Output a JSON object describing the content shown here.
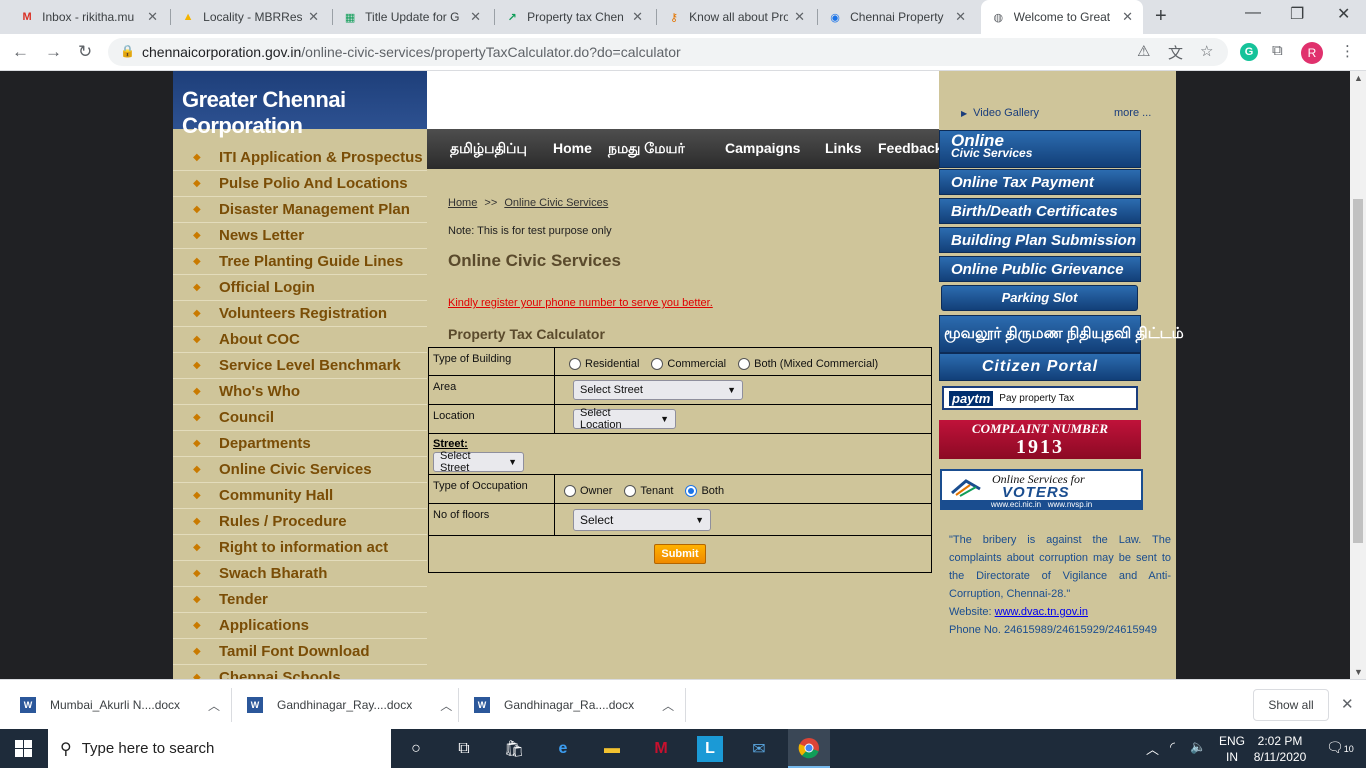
{
  "browser": {
    "tabs": [
      {
        "label": "Inbox - rikitha.mu",
        "icon": "gmail-icon",
        "glyph": "M",
        "color": "#d93025"
      },
      {
        "label": "Locality - MBRRes",
        "icon": "drive-icon",
        "glyph": "▲",
        "color": "#f4b400"
      },
      {
        "label": "Title Update for G",
        "icon": "sheets-icon",
        "glyph": "▦",
        "color": "#0f9d58"
      },
      {
        "label": "Property tax Chen",
        "icon": "trend-icon",
        "glyph": "↗",
        "color": "#0f9d58"
      },
      {
        "label": "Know all about Pro",
        "icon": "key-icon",
        "glyph": "⚷",
        "color": "#e37400"
      },
      {
        "label": "Chennai Property",
        "icon": "globe-icon",
        "glyph": "◉",
        "color": "#1a73e8"
      },
      {
        "label": "Welcome to Great",
        "icon": "globe-icon",
        "glyph": "◍",
        "color": "#5f6368"
      }
    ],
    "url_host": "chennaicorporation.gov.in",
    "url_path": "/online-civic-services/propertyTaxCalculator.do?do=calculator",
    "avatar_letter": "R",
    "ext_letter": "G"
  },
  "site": {
    "logo_text": "Greater Chennai Corporation",
    "left_menu": [
      "ITI Application & Prospectus",
      "Pulse Polio And Locations",
      "Disaster Management Plan",
      "News Letter",
      "Tree Planting Guide Lines",
      "Official Login",
      "Volunteers Registration",
      "About COC",
      "Service Level Benchmark",
      "Who's Who",
      "Council",
      "Departments",
      "Online Civic Services",
      "Community Hall",
      "Rules / Procedure",
      "Right to information act",
      "Swach Bharath",
      "Tender",
      "Applications",
      "Tamil Font Download",
      "Chennai Schools"
    ],
    "nav": [
      "தமிழ்பதிப்பு",
      "Home",
      "நமது மேயர்",
      "Campaigns",
      "Links",
      "Feedback"
    ],
    "breadcrumb_home": "Home",
    "breadcrumb_sep": ">>",
    "breadcrumb_current": "Online Civic Services",
    "note": "Note: This is for test purpose only",
    "page_title": "Online Civic Services",
    "register_link": "Kindly register your phone number to serve you better.",
    "calc_title": "Property Tax Calculator",
    "form": {
      "type_of_building_label": "Type of Building",
      "building_options": [
        "Residential",
        "Commercial",
        "Both (Mixed Commercial)"
      ],
      "area_label": "Area",
      "area_value": "Select Street",
      "location_label": "Location",
      "location_value": "Select Location",
      "street_label": "Street:",
      "street_value": "Select Street",
      "occupation_label": "Type of Occupation",
      "occupation_options": [
        "Owner",
        "Tenant",
        "Both"
      ],
      "occupation_selected": "Both",
      "floors_label": "No of floors",
      "floors_value": "Select",
      "submit_label": "Submit"
    },
    "right": {
      "video_gallery": "Video Gallery",
      "more": "more ...",
      "online_civic_1": "Online",
      "online_civic_2": "Civic Services",
      "buttons": [
        "Online Tax Payment",
        "Birth/Death Certificates",
        "Building Plan Submission",
        "Online Public Grievance"
      ],
      "parking": "Parking Slot",
      "tamil_scheme": "மூவலூர் திருமண நிதியுதவி திட்டம்",
      "citizen_portal": "Citizen Portal",
      "paytm": "paytm",
      "paytm_sub": "Pay property Tax",
      "complaint_label": "COMPLAINT NUMBER",
      "complaint_number": "1913",
      "voters_1": "Online Services for",
      "voters_2": "VOTERS",
      "voters_3": "www.eci.nic.in   www.nvsp.in",
      "quote": "\"The bribery is against the Law. The complaints about corruption may be sent to the Directorate of Vigilance and Anti-Corruption, Chennai-28.\"",
      "website_label": "Website:",
      "website": "www.dvac.tn.gov.in",
      "phone": "Phone No. 24615989/24615929/24615949"
    }
  },
  "downloads": {
    "items": [
      "Mumbai_Akurli N....docx",
      "Gandhinagar_Ray....docx",
      "Gandhinagar_Ra....docx"
    ],
    "show_all": "Show all"
  },
  "taskbar": {
    "search_placeholder": "Type here to search",
    "lang_1": "ENG",
    "lang_2": "IN",
    "time": "2:02 PM",
    "date": "8/11/2020",
    "notifications": "10"
  }
}
